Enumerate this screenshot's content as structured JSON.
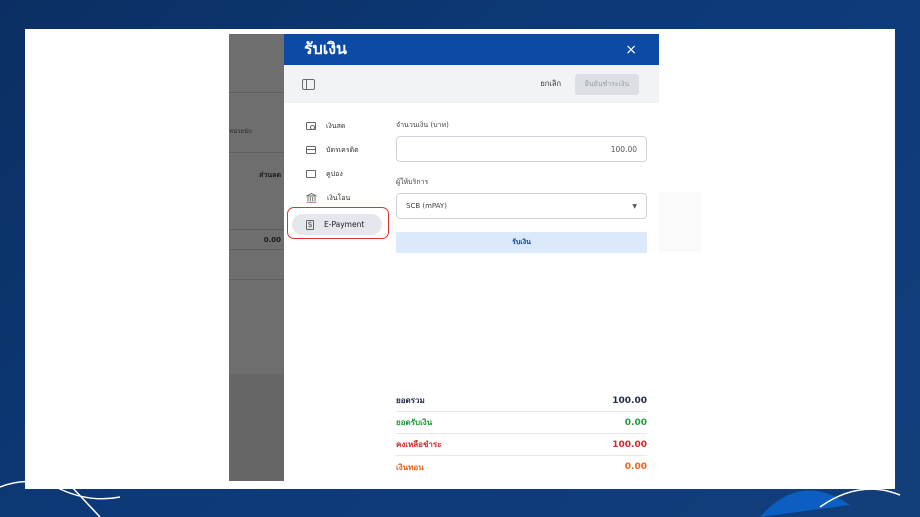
{
  "background_app": {
    "text_1": "หน่วยนับ",
    "text_2": "ส่วนลด",
    "text_3": "0.00"
  },
  "modal": {
    "title": "รับเงิน",
    "close_label": "×",
    "toolbar": {
      "cancel_label": "ยกเลิก",
      "confirm_label": "ยืนยันชำระเงิน"
    },
    "sidebar": {
      "items": [
        {
          "label": "เงินสด",
          "icon": "cash-icon"
        },
        {
          "label": "บัตรเครดิต",
          "icon": "credit-card-icon"
        },
        {
          "label": "คูปอง",
          "icon": "coupon-icon"
        },
        {
          "label": "เงินโอน",
          "icon": "bank-icon"
        },
        {
          "label": "E-Payment",
          "icon": "e-payment-icon"
        }
      ],
      "active_index": 4
    },
    "form": {
      "amount_label": "จำนวนเงิน (บาท)",
      "amount_value": "100.00",
      "provider_label": "ผู้ให้บริการ",
      "provider_value": "SCB (mPAY)",
      "receive_button": "รับเงิน"
    },
    "summary": [
      {
        "label": "ยอดรวม",
        "value": "100.00",
        "color": "#1f2a44"
      },
      {
        "label": "ยอดรับเงิน",
        "value": "0.00",
        "color": "#1e9b3c"
      },
      {
        "label": "คงเหลือชำระ",
        "value": "100.00",
        "color": "#d62828"
      },
      {
        "label": "เงินทอน",
        "value": "0.00",
        "color": "#e8641b"
      }
    ]
  },
  "colors": {
    "header_blue": "#0b4aa6",
    "highlight_red": "#e0322f",
    "slide_background": "#0c3a78"
  }
}
